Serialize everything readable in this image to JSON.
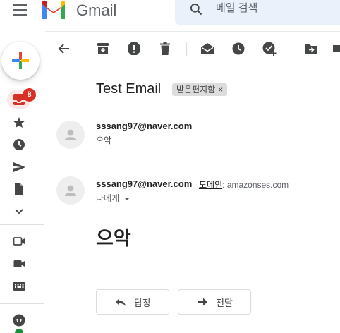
{
  "app": {
    "title": "Gmail"
  },
  "search": {
    "placeholder": "메일 검색"
  },
  "rail": {
    "inbox_badge": "8"
  },
  "thread": {
    "subject": "Test Email",
    "label": "받은편지함",
    "label_close": "×"
  },
  "messages": [
    {
      "sender": "sssang97@naver.com",
      "snippet": "으악"
    },
    {
      "sender": "sssang97@naver.com",
      "domain_label": "도메인",
      "domain_sep": ":",
      "domain_value": "amazonses.com",
      "to": "나에게",
      "body": "으악"
    }
  ],
  "actions": {
    "reply": "답장",
    "forward": "전달"
  },
  "colors": {
    "accent_red": "#d93025",
    "icon_gray": "#5f6368"
  }
}
